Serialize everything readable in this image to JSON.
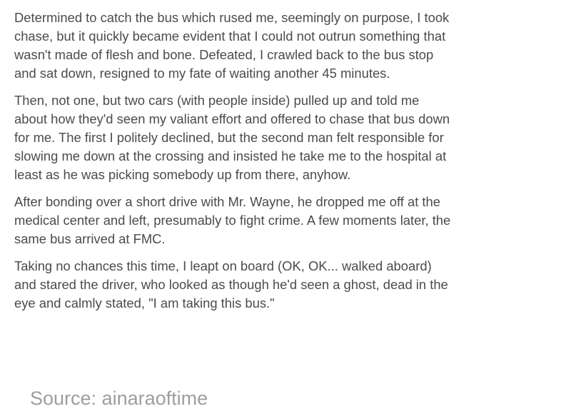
{
  "post": {
    "paragraphs": [
      {
        "lines": [
          "Determined to catch the bus which rused me, seemingly on purpose, I took",
          "chase, but it quickly became evident that I could not outrun something that",
          "wasn't made of flesh and bone. Defeated, I crawled back to the bus stop",
          "and sat down, resigned to my fate of waiting another 45 minutes."
        ]
      },
      {
        "lines": [
          "Then, not one, but two cars (with people inside) pulled up and told me",
          "about how they'd seen my valiant effort and offered to chase that bus down",
          "for me. The first I politely declined, but the second man felt responsible for",
          "slowing me down at the crossing and insisted he take me to the hospital at",
          "least as he was picking somebody up from there, anyhow."
        ]
      },
      {
        "lines": [
          "After bonding over a short drive with Mr. Wayne, he dropped me off at the",
          "medical center and left, presumably to fight crime. A few moments later, the",
          "same bus arrived at FMC."
        ]
      },
      {
        "lines": [
          "Taking no chances this time, I leapt on board (OK, OK... walked aboard)",
          "and stared the driver, who looked as though he'd seen a ghost, dead in the",
          "eye and calmly stated, \"I am taking this bus.\""
        ]
      }
    ],
    "source": "Source: ainaraoftime"
  }
}
